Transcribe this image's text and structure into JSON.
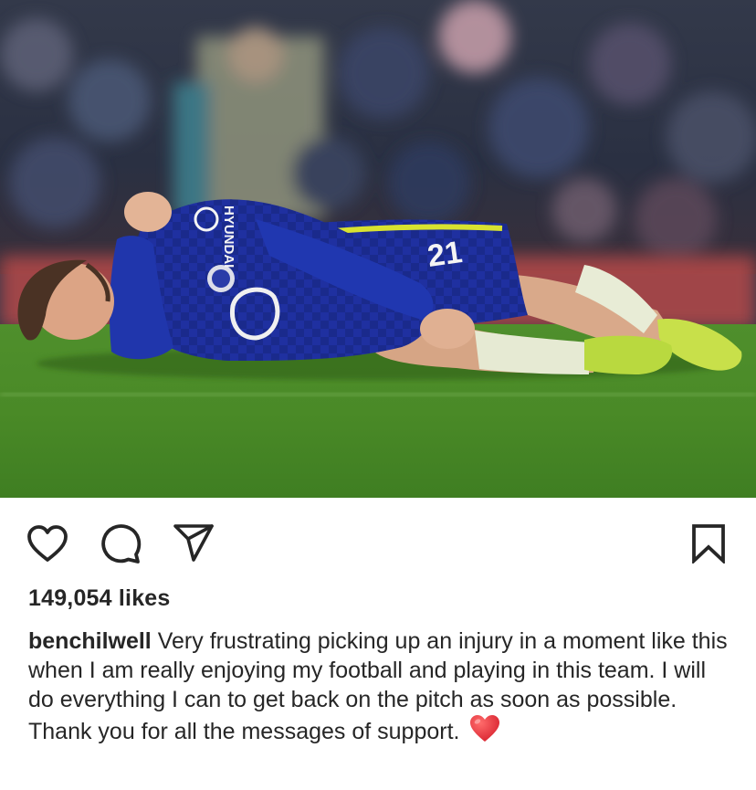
{
  "post": {
    "image_alt": "Football player in a blue kit lying injured on the pitch",
    "actions": {
      "like_icon": "heart-outline-icon",
      "comment_icon": "speech-bubble-icon",
      "share_icon": "paper-plane-icon",
      "save_icon": "bookmark-icon"
    },
    "likes_text": "149,054 likes",
    "caption": {
      "username": "benchilwell",
      "text": "Very frustrating picking up an injury in a moment like this when I am really enjoying my football and playing in this team. I will do everything I can to get back on the pitch as soon as possible. Thank you for all the messages of support.",
      "emoji": "❤️",
      "emoji_icon": "red-heart-emoji"
    },
    "kit": {
      "sponsor": "HYUNDAI",
      "shirt_number": "21"
    },
    "colors": {
      "icon": "#262626",
      "text": "#262626",
      "kit_blue": "#1d2e8f",
      "pitch_green": "#4e8d2a",
      "heart_red": "#e0323c"
    }
  }
}
